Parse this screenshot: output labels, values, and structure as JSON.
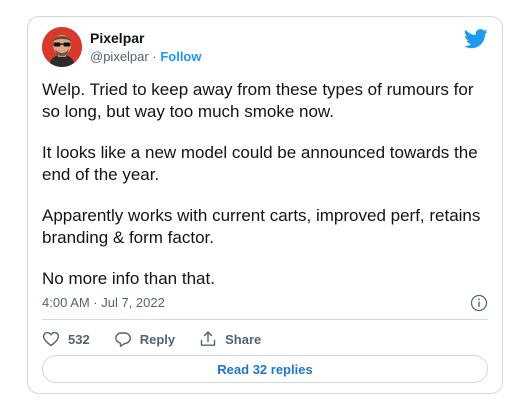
{
  "author": {
    "display_name": "Pixelpar",
    "handle": "@pixelpar",
    "separator": "·",
    "follow_label": "Follow"
  },
  "tweet": {
    "paragraphs": [
      "Welp. Tried to keep away from these types of rumours for so long, but way too much smoke now.",
      "It looks like a new model could be announced towards the end of the year.",
      "Apparently works with current carts, improved perf, retains branding & form factor.",
      "No more info than that."
    ],
    "timestamp": "4:00 AM · Jul 7, 2022"
  },
  "actions": {
    "likes_count": "532",
    "reply_label": "Reply",
    "share_label": "Share",
    "read_replies_label": "Read 32 replies"
  },
  "icons": {
    "brand": "twitter-bird-icon",
    "like": "heart-icon",
    "reply": "comment-icon",
    "share": "share-icon",
    "info": "info-icon"
  },
  "colors": {
    "accent": "#1d9bf0",
    "text": "#0f1419",
    "secondary_text": "#536471",
    "border": "#cfd9de",
    "avatar_bg": "#d8392b"
  }
}
